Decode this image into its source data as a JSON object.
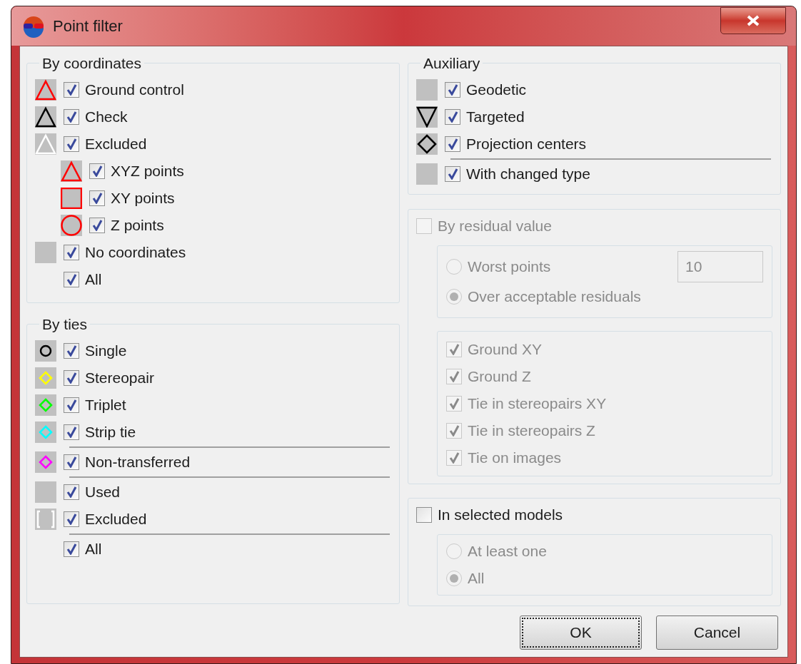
{
  "window": {
    "title": "Point filter"
  },
  "by_coordinates": {
    "title": "By coordinates",
    "items": [
      {
        "label": "Ground control",
        "checked": true,
        "kind": "triangle",
        "color": "#ff0000"
      },
      {
        "label": "Check",
        "checked": true,
        "kind": "triangle",
        "color": "#000000"
      },
      {
        "label": "Excluded",
        "checked": true,
        "kind": "triangle",
        "color": "#ffffff",
        "children": [
          {
            "label": "XYZ points",
            "checked": true,
            "kind": "triangle",
            "color": "#ff0000"
          },
          {
            "label": "XY points",
            "checked": true,
            "kind": "square",
            "color": "#ff0000"
          },
          {
            "label": "Z points",
            "checked": true,
            "kind": "circle",
            "color": "#ff0000"
          }
        ]
      },
      {
        "label": "No coordinates",
        "checked": true,
        "kind": "plain"
      },
      {
        "label": "All",
        "checked": true,
        "kind": "none"
      }
    ]
  },
  "by_ties": {
    "title": "By ties",
    "items": [
      {
        "label": "Single",
        "checked": true,
        "kind": "small-circle",
        "color": "#000000",
        "separator_below": false
      },
      {
        "label": "Stereopair",
        "checked": true,
        "kind": "small-diamond",
        "color": "#ffff00",
        "separator_below": false
      },
      {
        "label": "Triplet",
        "checked": true,
        "kind": "small-diamond",
        "color": "#00ff00",
        "separator_below": false
      },
      {
        "label": "Strip tie",
        "checked": true,
        "kind": "small-diamond",
        "color": "#00ffff",
        "separator_below": true
      },
      {
        "label": "Non-transferred",
        "checked": true,
        "kind": "small-diamond",
        "color": "#ff00ff",
        "separator_below": true
      },
      {
        "label": "Used",
        "checked": true,
        "kind": "plain",
        "separator_below": false
      },
      {
        "label": "Excluded",
        "checked": true,
        "kind": "bracket",
        "color": "#ffffff",
        "separator_below": true
      },
      {
        "label": "All",
        "checked": true,
        "kind": "none",
        "separator_below": false
      }
    ]
  },
  "auxiliary": {
    "title": "Auxiliary",
    "items": [
      {
        "label": "Geodetic",
        "checked": true,
        "kind": "plain",
        "separator_below": false
      },
      {
        "label": "Targeted",
        "checked": true,
        "kind": "inverted-triangle",
        "color": "#000000",
        "separator_below": false
      },
      {
        "label": "Projection centers",
        "checked": true,
        "kind": "diamond",
        "color": "#000000",
        "separator_below": true
      },
      {
        "label": "With changed type",
        "checked": true,
        "kind": "plain",
        "separator_below": false
      }
    ]
  },
  "by_residual": {
    "label": "By residual value",
    "checked": false,
    "disabled": true,
    "modes": [
      {
        "label": "Worst points",
        "selected": false
      },
      {
        "label": "Over acceptable residuals",
        "selected": true
      }
    ],
    "worst_count": "10",
    "point_types": [
      {
        "label": "Ground XY",
        "checked": true
      },
      {
        "label": "Ground Z",
        "checked": true
      },
      {
        "label": "Tie in stereopairs XY",
        "checked": true
      },
      {
        "label": "Tie in stereopairs Z",
        "checked": true
      },
      {
        "label": "Tie on images",
        "checked": true
      }
    ]
  },
  "in_selected_models": {
    "label": "In selected models",
    "checked": false,
    "options_disabled": true,
    "options": [
      {
        "label": "At least one",
        "selected": false
      },
      {
        "label": "All",
        "selected": true
      }
    ]
  },
  "buttons": [
    {
      "label": "OK",
      "focused": true
    },
    {
      "label": "Cancel",
      "focused": false
    }
  ]
}
